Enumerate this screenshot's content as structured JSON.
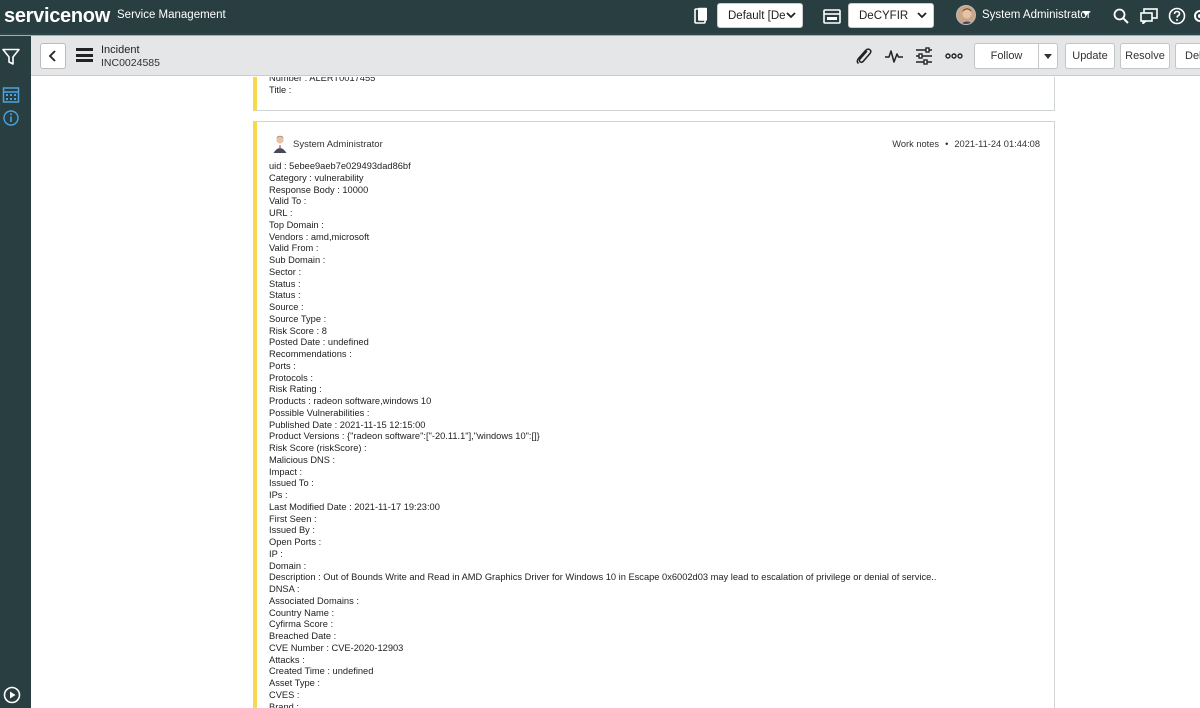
{
  "topnav": {
    "logo": "servicenow",
    "app_title": "Service Management",
    "update_set_value": "Default [De",
    "scope_value": "DeCYFIR",
    "user_name": "System Administrator",
    "icons": [
      "update-set-icon",
      "application-scope-icon",
      "search-icon",
      "connect-chat-icon",
      "help-icon",
      "settings-icon"
    ]
  },
  "leftrail": {
    "icons": [
      "filter-navigator-icon",
      "calendar-grid-icon",
      "info-icon",
      "play-icon"
    ]
  },
  "form_header": {
    "record_type": "Incident",
    "record_number": "INC0024585",
    "icons": [
      "paperclip-icon",
      "activity-icon",
      "personalize-form-icon",
      "more-options-icon"
    ],
    "buttons": {
      "follow": "Follow",
      "update": "Update",
      "resolve": "Resolve",
      "delete": "Del"
    }
  },
  "activity": {
    "card1_lines": [
      "Number : ALERT0017455",
      "Title :"
    ],
    "card2": {
      "author": "System Administrator",
      "note_type": "Work notes",
      "timestamp": "2021-11-24 01:44:08",
      "lines": [
        "uid : 5ebee9aeb7e029493dad86bf",
        "Category : vulnerability",
        "Response Body : 10000",
        "Valid To :",
        "URL :",
        "Top Domain :",
        "Vendors : amd,microsoft",
        "Valid From :",
        "Sub Domain :",
        "Sector :",
        "Status :",
        "Status :",
        "Source :",
        "Source Type :",
        "Risk Score : 8",
        "Posted Date : undefined",
        "Recommendations :",
        "Ports :",
        "Protocols :",
        "Risk Rating :",
        "Products : radeon software,windows 10",
        "Possible Vulnerabilities :",
        "Published Date : 2021-11-15 12:15:00",
        "Product Versions : {\"radeon software\":[\"-20.11.1\"],\"windows 10\":[]}",
        "Risk Score (riskScore) :",
        "Malicious DNS :",
        "Impact :",
        "Issued To :",
        "IPs :",
        "Last Modified Date : 2021-11-17 19:23:00",
        "First Seen :",
        "Issued By :",
        "Open Ports :",
        "IP :",
        "Domain :",
        "Description : Out of Bounds Write and Read in AMD Graphics Driver for Windows 10 in Escape 0x6002d03 may lead to escalation of privilege or denial of service..",
        "DNSA :",
        "Associated Domains :",
        "Country Name :",
        "Cyfirma Score :",
        "Breached Date :",
        "CVE Number : CVE-2020-12903",
        "Attacks :",
        "Created Time : undefined",
        "Asset Type :",
        "CVES :",
        "Brand :"
      ]
    }
  }
}
